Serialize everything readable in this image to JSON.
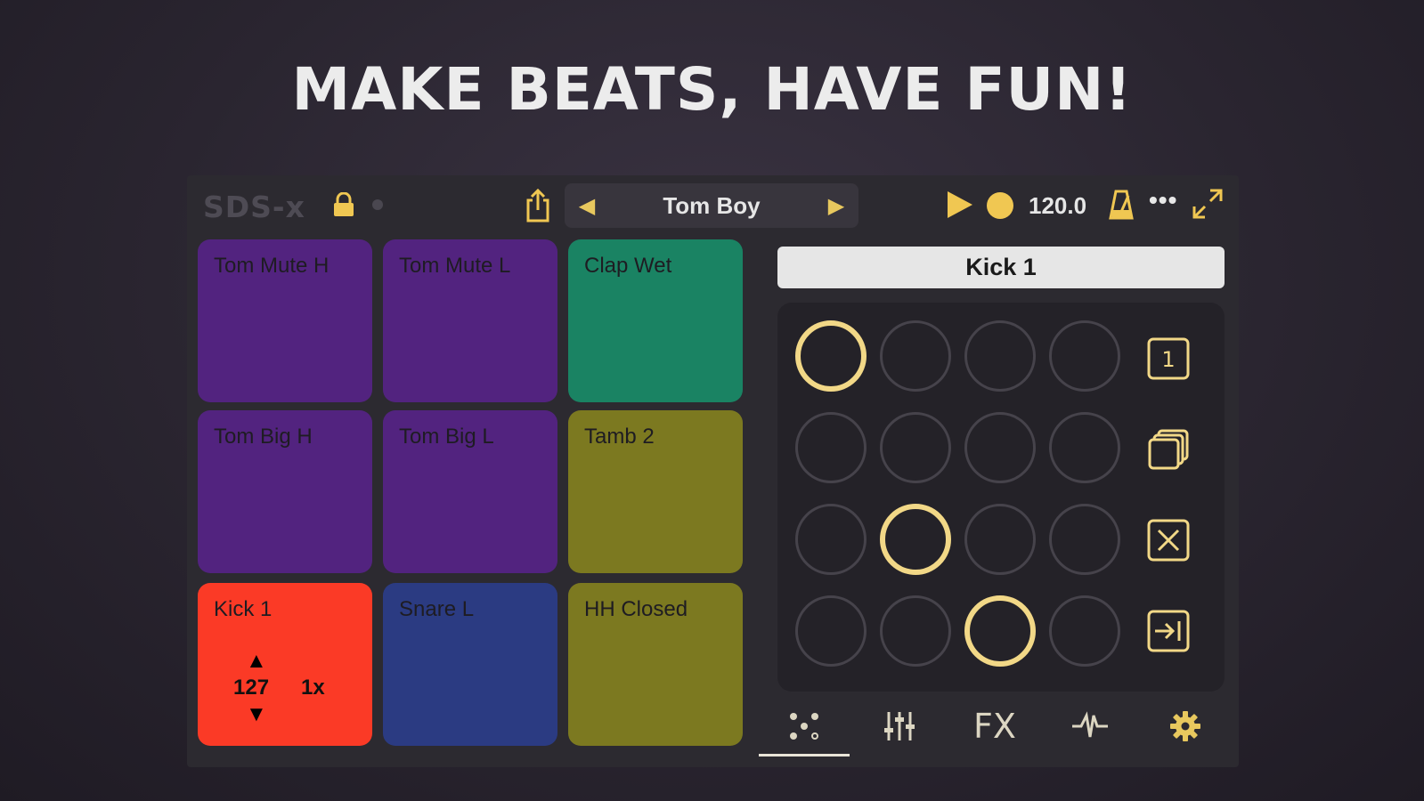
{
  "headline": "MAKE BEATS, HAVE FUN!",
  "topbar": {
    "brand": "SDS-x",
    "preset_name": "Tom Boy",
    "tempo": "120.0",
    "more": "•••"
  },
  "pads": [
    {
      "label": "Tom Mute H",
      "color": "#52237f"
    },
    {
      "label": "Tom Mute L",
      "color": "#52237f"
    },
    {
      "label": "Clap Wet",
      "color": "#1a8363"
    },
    {
      "label": "Tom Big H",
      "color": "#52237f"
    },
    {
      "label": "Tom Big L",
      "color": "#52237f"
    },
    {
      "label": "Tamb 2",
      "color": "#7c7920"
    },
    {
      "label": "Kick 1",
      "color": "#fb3a26"
    },
    {
      "label": "Snare L",
      "color": "#2b3b82"
    },
    {
      "label": "HH Closed",
      "color": "#7c7920"
    }
  ],
  "selected_pad": {
    "name": "Kick 1",
    "velocity": "127",
    "repeat": "1x",
    "up_arrow": "▲",
    "down_arrow": "▼"
  },
  "sequencer": {
    "steps": [
      [
        true,
        false,
        false,
        false
      ],
      [
        false,
        false,
        false,
        false
      ],
      [
        false,
        true,
        false,
        false
      ],
      [
        false,
        false,
        true,
        false
      ]
    ],
    "side_icons": [
      "pattern-1-icon",
      "duplicate-icon",
      "clear-icon",
      "next-icon"
    ],
    "pattern_number": "1",
    "active_color": "#f2d887"
  },
  "tabs": {
    "items": [
      "pattern-icon",
      "mixer-icon",
      "FX",
      "waveform-icon",
      "settings-icon"
    ],
    "fx_label": "FX",
    "active": 0
  },
  "colors": {
    "accent": "#f0c752",
    "background": "#2c2a30"
  }
}
